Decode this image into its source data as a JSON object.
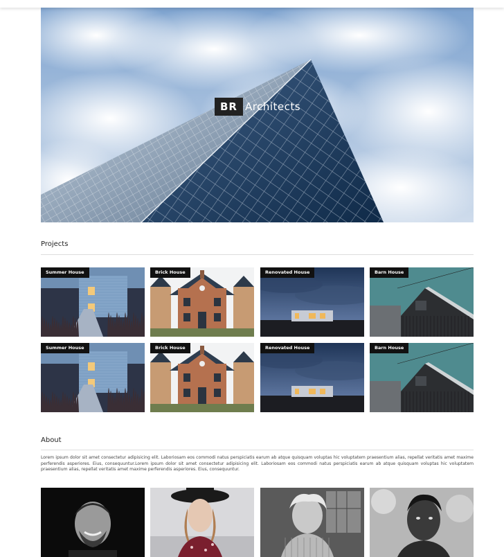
{
  "brand": {
    "initials": "BR",
    "name": "Architects"
  },
  "sections": {
    "projects": {
      "title": "Projects"
    },
    "about": {
      "title": "About"
    }
  },
  "projects": [
    {
      "label": "Summer House",
      "image": "summer-house-photo"
    },
    {
      "label": "Brick House",
      "image": "brick-house-photo"
    },
    {
      "label": "Renovated House",
      "image": "renovated-house-photo"
    },
    {
      "label": "Barn House",
      "image": "barn-house-photo"
    },
    {
      "label": "Summer House",
      "image": "summer-house-photo"
    },
    {
      "label": "Brick House",
      "image": "brick-house-photo"
    },
    {
      "label": "Renovated House",
      "image": "renovated-house-photo"
    },
    {
      "label": "Barn House",
      "image": "barn-house-photo"
    }
  ],
  "about": {
    "text": "Lorem ipsum dolor sit amet consectetur adipisicing elit. Laboriosam eos commodi natus perspiciatis earum ab atque quisquam voluptas hic voluptatem praesentium alias, repellat veritatis amet maxime perferendis asperiores. Eius, consequuntur.Lorem ipsum dolor sit amet consectetur adipisicing elit. Laboriosam eos commodi natus perspiciatis earum ab atque quisquam voluptas hic voluptatem praesentium alias, repellat veritatis amet maxime perferendis asperiores. Eius, consequuntur."
  },
  "team": [
    {
      "image": "team-member-1-portrait"
    },
    {
      "image": "team-member-2-portrait"
    },
    {
      "image": "team-member-3-portrait"
    },
    {
      "image": "team-member-4-portrait"
    }
  ]
}
